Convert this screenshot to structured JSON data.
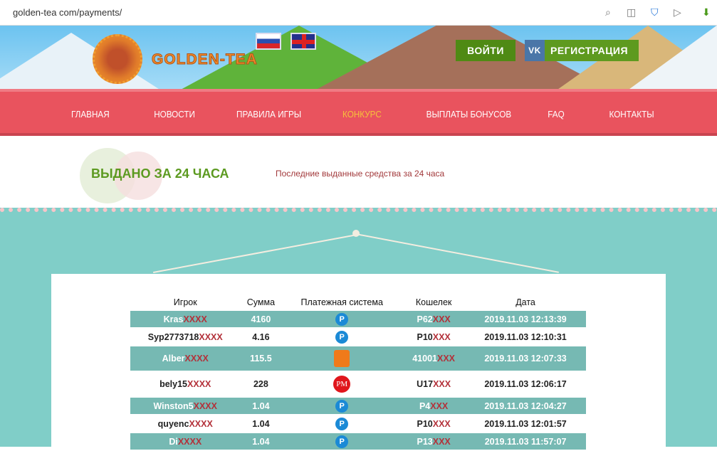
{
  "browser": {
    "url": "golden-tea com/payments/"
  },
  "site": {
    "logo_text": "GOLDEN-TEA",
    "login": "ВОЙТИ",
    "register": "РЕГИСТРАЦИЯ",
    "vk": "VK"
  },
  "nav": [
    "ГЛАВНАЯ",
    "НОВОСТИ",
    "ПРАВИЛА ИГРЫ",
    "КОНКУРС",
    "ВЫПЛАТЫ БОНУСОВ",
    "FAQ",
    "КОНТАКТЫ"
  ],
  "colors": {
    "nav_bg": "#e9535e",
    "nav_active": "#f6c23b",
    "teal": "#80cec8",
    "row_alt": "#76b9b3",
    "mask": "#b3313a"
  },
  "section": {
    "title": "ВЫДАНО ЗА 24 ЧАСА",
    "subtitle": "Последние выданные средства за 24 часа"
  },
  "table": {
    "headers": [
      "Игрок",
      "Сумма",
      "Платежная система",
      "Кошелек",
      "Дата"
    ],
    "rows": [
      {
        "player": "Kras",
        "pmask": "XXXX",
        "amount": "4160",
        "system": "P",
        "wallet": "P62",
        "wmask": "XXX",
        "date": "2019.11.03 12:13:39"
      },
      {
        "player": "Syp2773718",
        "pmask": "XXXX",
        "amount": "4.16",
        "system": "P",
        "wallet": "P10",
        "wmask": "XXX",
        "date": "2019.11.03 12:10:31"
      },
      {
        "player": "Alber",
        "pmask": "XXXX",
        "amount": "115.5",
        "system": "YM",
        "wallet": "41001",
        "wmask": "XXX",
        "date": "2019.11.03 12:07:33"
      },
      {
        "player": "bely15",
        "pmask": "XXXX",
        "amount": "228",
        "system": "PM",
        "wallet": "U17",
        "wmask": "XXX",
        "date": "2019.11.03 12:06:17"
      },
      {
        "player": "Winston5",
        "pmask": "XXXX",
        "amount": "1.04",
        "system": "P",
        "wallet": "P4",
        "wmask": "XXX",
        "date": "2019.11.03 12:04:27"
      },
      {
        "player": "quyenc",
        "pmask": "XXXX",
        "amount": "1.04",
        "system": "P",
        "wallet": "P10",
        "wmask": "XXX",
        "date": "2019.11.03 12:01:57"
      },
      {
        "player": "Di",
        "pmask": "XXXX",
        "amount": "1.04",
        "system": "P",
        "wallet": "P13",
        "wmask": "XXX",
        "date": "2019.11.03 11:57:07"
      }
    ]
  }
}
